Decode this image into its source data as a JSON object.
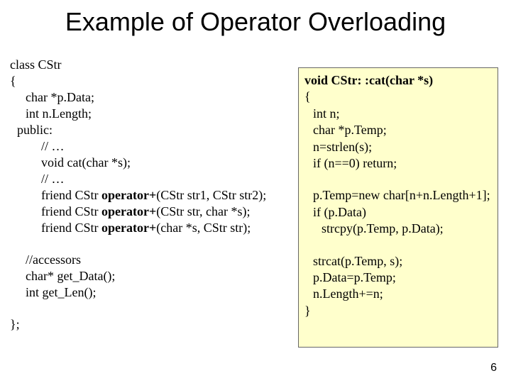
{
  "title": "Example of Operator Overloading",
  "left": {
    "l1": "class CStr",
    "l2": "{",
    "l3": "char *p.Data;",
    "l4": "int n.Length;",
    "l5": "public:",
    "l6": "// …",
    "l7": "void cat(char *s);",
    "l8": "// …",
    "l9a": "friend CStr ",
    "l9b": "operator+",
    "l9c": "(CStr str1, CStr str2);",
    "l10a": "friend CStr ",
    "l10b": "operator+",
    "l10c": "(CStr str, char *s);",
    "l11a": "friend CStr ",
    "l11b": "operator+",
    "l11c": "(char *s, CStr str);",
    "l12": "//accessors",
    "l13": "char* get_Data();",
    "l14": "int get_Len();",
    "l15": "};"
  },
  "right": {
    "r1": "void CStr: :cat(char *s)",
    "r2": "{",
    "r3": "int n;",
    "r4": "char *p.Temp;",
    "r5": "n=strlen(s);",
    "r6": "if (n==0) return;",
    "r7": "p.Temp=new char[n+n.Length+1];",
    "r8": "if (p.Data)",
    "r9": "strcpy(p.Temp, p.Data);",
    "r10": "strcat(p.Temp, s);",
    "r11": "p.Data=p.Temp;",
    "r12": "n.Length+=n;",
    "r13": "}"
  },
  "pagenum": "6"
}
